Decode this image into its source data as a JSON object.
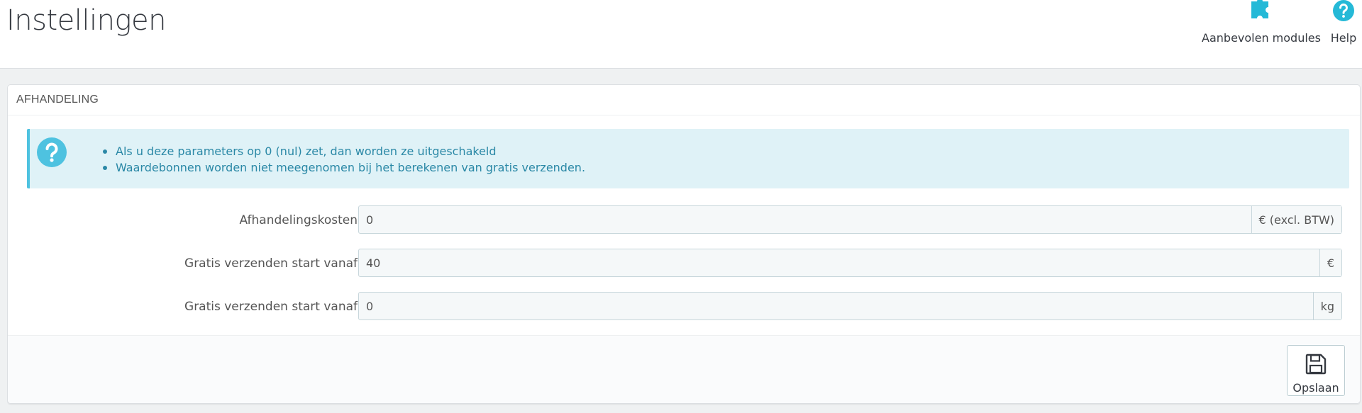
{
  "page": {
    "title": "Instellingen"
  },
  "toolbar": {
    "modules_label": "Aanbevolen modules",
    "help_label": "Help",
    "icon_color": "#25b9d7"
  },
  "panel": {
    "heading": "AFHANDELING",
    "alert_items": [
      "Als u deze parameters op 0 (nul) zet, dan worden ze uitgeschakeld",
      "Waardebonnen worden niet meegenomen bij het berekenen van gratis verzenden."
    ],
    "fields": [
      {
        "label": "Afhandelingskosten",
        "value": "0",
        "suffix": "€ (excl. BTW)"
      },
      {
        "label": "Gratis verzenden start vanaf",
        "value": "40",
        "suffix": "€"
      },
      {
        "label": "Gratis verzenden start vanaf",
        "value": "0",
        "suffix": "kg"
      }
    ],
    "save_label": "Opslaan"
  }
}
